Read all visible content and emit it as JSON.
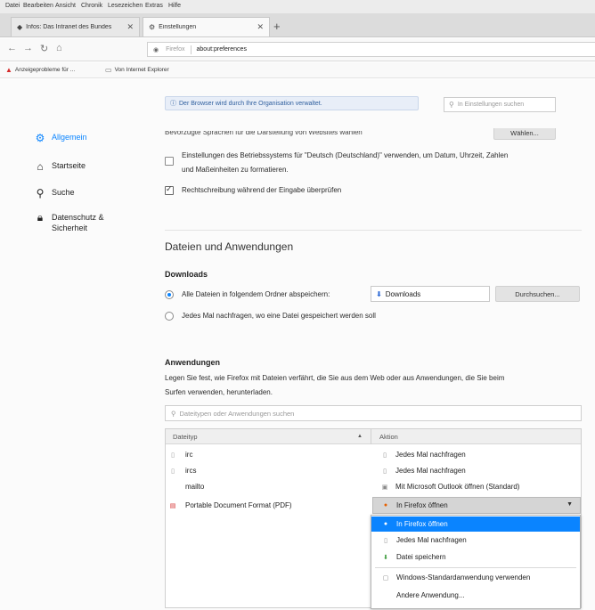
{
  "menubar": {
    "items": [
      "Datei",
      "Bearbeiten",
      "Ansicht",
      "Chronik",
      "Lesezeichen",
      "Extras",
      "Hilfe"
    ]
  },
  "tabs": [
    {
      "icon": "intranet-icon",
      "label": "Infos: Das Intranet des Bundes",
      "active": false
    },
    {
      "icon": "gear-icon",
      "label": "Einstellungen",
      "active": true
    }
  ],
  "navbar": {
    "back": "←",
    "forward": "→",
    "reload": "↻",
    "home": "⌂",
    "identity": "Firefox",
    "url": "about:preferences"
  },
  "bookmarks": [
    {
      "icon": "adobe-icon",
      "label": "Anzeigeprobleme für ..."
    },
    {
      "icon": "folder-icon",
      "label": "Von Internet Explorer"
    }
  ],
  "sidebar": {
    "items": [
      {
        "icon": "gear-icon",
        "label": "Allgemein",
        "active": true
      },
      {
        "icon": "home-icon",
        "label": "Startseite",
        "active": false
      },
      {
        "icon": "search-icon",
        "label": "Suche",
        "active": false
      },
      {
        "icon": "lock-icon",
        "label": "Datenschutz & Sicherheit",
        "active": false
      }
    ]
  },
  "notice": "Der Browser wird durch Ihre Organisation verwaltet.",
  "search_settings": {
    "placeholder": "In Einstellungen suchen"
  },
  "language": {
    "cut_text": "Bevorzugte Sprachen für die Darstellung von Websites wählen",
    "choose_button": "Wählen...",
    "os_locale_line1": "Einstellungen des Betriebssystems für \"Deutsch (Deutschland)\" verwenden, um Datum, Uhrzeit, Zahlen",
    "os_locale_line2": "und Maßeinheiten zu formatieren.",
    "os_locale_checked": false,
    "spellcheck": "Rechtschreibung während der Eingabe überprüfen",
    "spellcheck_checked": true
  },
  "files": {
    "heading": "Dateien und Anwendungen",
    "downloads_heading": "Downloads",
    "save_to_label": "Alle Dateien in folgendem Ordner abspeichern:",
    "save_to_checked": true,
    "folder": "Downloads",
    "browse_button": "Durchsuchen...",
    "always_ask": "Jedes Mal nachfragen, wo eine Datei gespeichert werden soll",
    "always_ask_checked": false
  },
  "applications": {
    "heading": "Anwendungen",
    "desc_line1": "Legen Sie fest, wie Firefox mit Dateien verfährt, die Sie aus dem Web oder aus Anwendungen, die Sie beim",
    "desc_line2": "Surfen verwenden, herunterladen.",
    "filter_placeholder": "Dateitypen oder Anwendungen suchen",
    "col_type": "Dateityp",
    "col_action": "Aktion",
    "sort_indicator": "▲",
    "rows": [
      {
        "icon": "generic-file-icon",
        "type": "irc",
        "action_icon": "generic-file-icon",
        "action": "Jedes Mal nachfragen"
      },
      {
        "icon": "generic-file-icon",
        "type": "ircs",
        "action_icon": "generic-file-icon",
        "action": "Jedes Mal nachfragen"
      },
      {
        "icon": "",
        "type": "mailto",
        "action_icon": "outlook-icon",
        "action": "Mit Microsoft Outlook öffnen (Standard)"
      },
      {
        "icon": "pdf-icon",
        "type": "Portable Document Format (PDF)",
        "action_icon": "firefox-icon",
        "action": "In Firefox öffnen"
      }
    ],
    "dropdown_options": [
      {
        "icon": "firefox-icon",
        "label": "In Firefox öffnen",
        "highlight": true
      },
      {
        "icon": "generic-file-icon",
        "label": "Jedes Mal nachfragen",
        "highlight": false
      },
      {
        "icon": "save-icon",
        "label": "Datei speichern",
        "highlight": false
      },
      {
        "icon": "windows-app-icon",
        "label": "Windows-Standardanwendung verwenden",
        "highlight": false
      },
      {
        "icon": "",
        "label": "Andere Anwendung...",
        "highlight": false
      }
    ]
  }
}
